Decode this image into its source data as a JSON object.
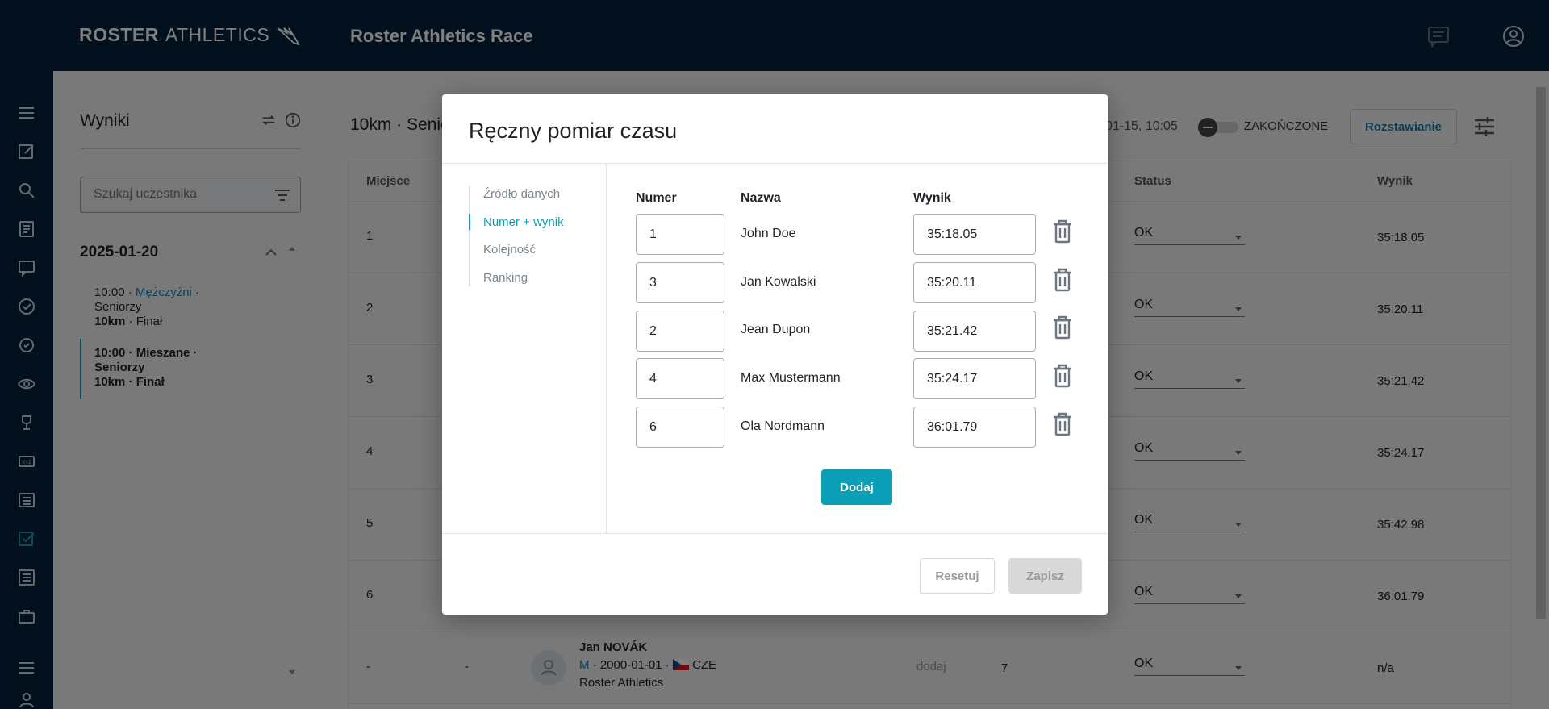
{
  "header": {
    "logo_bold": "ROSTER",
    "logo_thin": "ATHLETICS",
    "title": "Roster Athletics Race"
  },
  "sidebar": {
    "title": "Wyniki",
    "search_placeholder": "Szukaj uczestnika",
    "date": "2025-01-20",
    "events": [
      {
        "line1a": "10:00 · ",
        "line1b": "Mężczyźni",
        "line1c": " ·",
        "line2": "Seniorzy",
        "line3a": "10km",
        "line3b": " · Finał"
      },
      {
        "line1a": "10:00 · Mieszane ·",
        "line2": "Seniorzy",
        "line3a": "10km",
        "line3b": " · Finał"
      }
    ]
  },
  "main": {
    "title": "10km · Senio",
    "date": "01-15, 10:05",
    "toggle_label": "ZAKOŃCZONE",
    "seed_button": "Rozstawianie",
    "columns": {
      "place": "Miejsce",
      "status": "Status",
      "result": "Wynik"
    },
    "rows": [
      {
        "place": "1",
        "status": "OK",
        "result": "35:18.05"
      },
      {
        "place": "2",
        "status": "OK",
        "result": "35:20.11"
      },
      {
        "place": "3",
        "status": "OK",
        "result": "35:21.42"
      },
      {
        "place": "4",
        "status": "OK",
        "result": "35:24.17"
      },
      {
        "place": "5",
        "status": "OK",
        "result": "35:42.98"
      },
      {
        "place": "6",
        "status": "OK",
        "result": "36:01.79"
      }
    ],
    "last_row": {
      "place": "-",
      "col2": "-",
      "athlete_name": "Jan NOVÁK",
      "athlete_gender": "M",
      "athlete_meta": " · 2000-01-01 · ",
      "athlete_country": "CZE",
      "athlete_club": "Roster Athletics",
      "add_link": "dodaj",
      "bib": "7",
      "status": "OK",
      "result": "n/a"
    }
  },
  "modal": {
    "title": "Ręczny pomiar czasu",
    "steps": [
      "Źródło danych",
      "Numer + wynik",
      "Kolejność",
      "Ranking"
    ],
    "active_step": 1,
    "columns": {
      "number": "Numer",
      "name": "Nazwa",
      "result": "Wynik"
    },
    "entries": [
      {
        "number": "1",
        "name": "John Doe",
        "result": "35:18.05"
      },
      {
        "number": "3",
        "name": "Jan Kowalski",
        "result": "35:20.11"
      },
      {
        "number": "2",
        "name": "Jean Dupon",
        "result": "35:21.42"
      },
      {
        "number": "4",
        "name": "Max Mustermann",
        "result": "35:24.17"
      },
      {
        "number": "6",
        "name": "Ola Nordmann",
        "result": "36:01.79"
      }
    ],
    "add_button": "Dodaj",
    "reset_button": "Resetuj",
    "save_button": "Zapisz"
  },
  "colors": {
    "navy": "#06233f",
    "accent": "#0a9fb7",
    "link": "#1a86b7"
  }
}
